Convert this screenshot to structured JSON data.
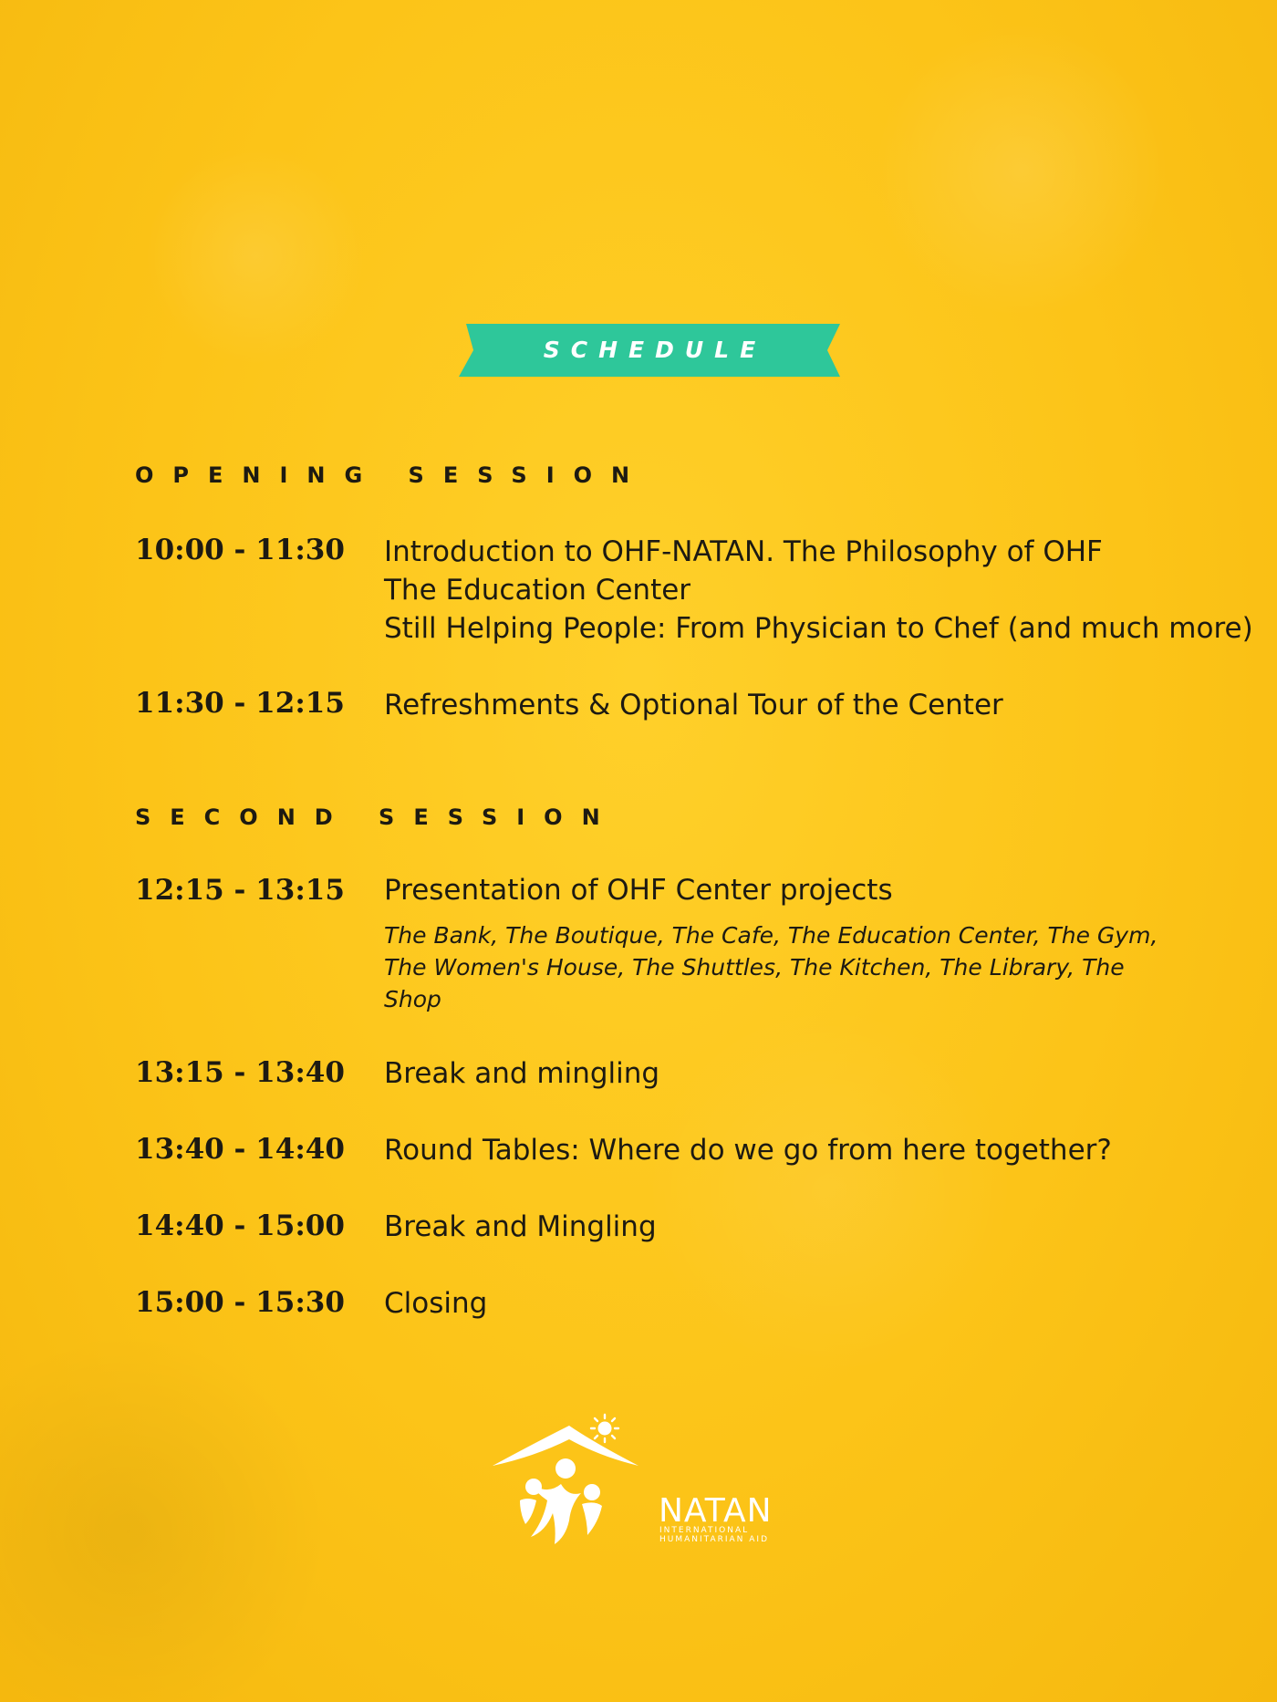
{
  "banner": {
    "label": "SCHEDULE",
    "color": "#2ec79a"
  },
  "sessions": [
    {
      "heading": "OPENING SESSION",
      "items": [
        {
          "time": "10:00 - 11:30",
          "lines": [
            "Introduction to OHF-NATAN. The Philosophy of OHF",
            "The Education Center",
            "Still Helping People: From Physician to Chef (and much more)"
          ]
        },
        {
          "time": "11:30 - 12:15",
          "lines": [
            "Refreshments & Optional Tour of the Center"
          ]
        }
      ]
    },
    {
      "heading": "SECOND SESSION",
      "items": [
        {
          "time": "12:15 - 13:15",
          "lines": [
            "Presentation of OHF Center projects"
          ],
          "detail": "The Bank, The Boutique, The Cafe, The Education Center, The Gym, The Women's House, The Shuttles, The Kitchen, The Library, The Shop"
        },
        {
          "time": "13:15 - 13:40",
          "lines": [
            "Break and mingling"
          ]
        },
        {
          "time": "13:40 - 14:40",
          "lines": [
            "Round Tables: Where do we go from here together?"
          ]
        },
        {
          "time": "14:40 - 15:00",
          "lines": [
            "Break and Mingling"
          ]
        },
        {
          "time": "15:00 - 15:30",
          "lines": [
            "Closing"
          ]
        }
      ]
    }
  ],
  "logo": {
    "name": "NATAN",
    "tagline_1": "INTERNATIONAL",
    "tagline_2": "HUMANITARIAN AID",
    "icon": "natan-house-family-sun-icon"
  },
  "colors": {
    "background": "#fcc418",
    "text": "#1d1a12",
    "logo": "#ffffff"
  }
}
